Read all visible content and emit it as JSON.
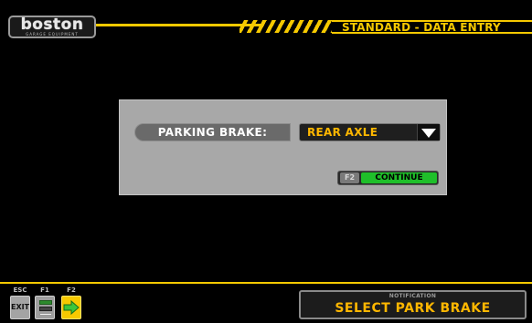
{
  "header": {
    "logo": {
      "word": "boston",
      "sub": "GARAGE EQUIPMENT"
    },
    "title": "STANDARD - DATA ENTRY"
  },
  "dialog": {
    "parking_brake_label": "PARKING BRAKE:",
    "parking_brake_value": "REAR AXLE",
    "continue_key": "F2",
    "continue_label": "CONTINUE"
  },
  "footer": {
    "keys": [
      {
        "key": "ESC",
        "label": "EXIT"
      },
      {
        "key": "F1",
        "icon": "keyboard-icon"
      },
      {
        "key": "F2",
        "icon": "arrow-right-icon"
      }
    ],
    "notification": {
      "label": "NOTIFICATION",
      "text": "SELECT PARK BRAKE"
    }
  },
  "colors": {
    "accent": "#f6c900",
    "value_text": "#ffb700",
    "continue_green": "#1fbf2a",
    "dialog_bg": "#a8a8a8",
    "background": "#000000"
  }
}
